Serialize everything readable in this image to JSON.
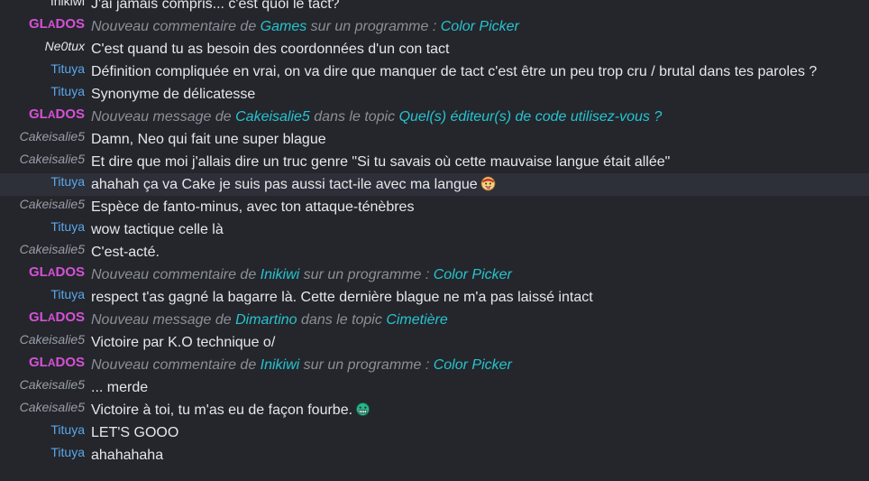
{
  "messages": [
    {
      "author": "Inikiwi",
      "type": "user",
      "text": "J'ai jamais compris... c'est quoi le tact?"
    },
    {
      "author": "GLADOS",
      "type": "system",
      "parts": [
        "Nouveau commentaire de ",
        "Games",
        " sur un programme : ",
        "Color Picker"
      ]
    },
    {
      "author": "Ne0tux",
      "type": "user",
      "text": "C'est quand tu as besoin des coordonnées d'un con tact"
    },
    {
      "author": "Tituya",
      "type": "user",
      "text": "Définition compliquée en vrai, on va dire que manquer de tact c'est être un peu trop cru / brutal dans tes paroles ?"
    },
    {
      "author": "Tituya",
      "type": "user",
      "text": "Synonyme de délicatesse"
    },
    {
      "author": "GLADOS",
      "type": "system",
      "parts": [
        "Nouveau message de ",
        "Cakeisalie5",
        " dans le topic ",
        "Quel(s) éditeur(s) de code utilisez-vous ?"
      ]
    },
    {
      "author": "Cakeisalie5",
      "type": "user",
      "text": "Damn, Neo qui fait une super blague"
    },
    {
      "author": "Cakeisalie5",
      "type": "user",
      "text": "Et dire que moi j'allais dire un truc genre \"Si tu savais où cette mauvaise langue était allée\""
    },
    {
      "author": "Tituya",
      "type": "user",
      "text": "ahahah ça va Cake je suis pas aussi tact-ile avec ma langue",
      "emoji": "tongue-emoji"
    },
    {
      "author": "Cakeisalie5",
      "type": "user",
      "text": "Espèce de fanto-minus, avec ton attaque-ténèbres"
    },
    {
      "author": "Tituya",
      "type": "user",
      "text": "wow tactique celle là"
    },
    {
      "author": "Cakeisalie5",
      "type": "user",
      "text": "C'est-acté."
    },
    {
      "author": "GLADOS",
      "type": "system",
      "parts": [
        "Nouveau commentaire de ",
        "Inikiwi",
        " sur un programme : ",
        "Color Picker"
      ]
    },
    {
      "author": "Tituya",
      "type": "user",
      "text": "respect t'as gagné la bagarre là. Cette dernière blague ne m'a pas laissé intact"
    },
    {
      "author": "GLADOS",
      "type": "system",
      "parts": [
        "Nouveau message de ",
        "Dimartino",
        " dans le topic ",
        "Cimetière"
      ]
    },
    {
      "author": "Cakeisalie5",
      "type": "user",
      "text": "Victoire par K.O technique o/"
    },
    {
      "author": "GLADOS",
      "type": "system",
      "parts": [
        "Nouveau commentaire de ",
        "Inikiwi",
        " sur un programme : ",
        "Color Picker"
      ]
    },
    {
      "author": "Cakeisalie5",
      "type": "user",
      "text": "... merde"
    },
    {
      "author": "Cakeisalie5",
      "type": "user",
      "text": "Victoire à toi, tu m'as eu de façon fourbe.",
      "emoji": "grin-emoji"
    },
    {
      "author": "Tituya",
      "type": "user",
      "text": "LET'S GOOO"
    },
    {
      "author": "Tituya",
      "type": "user",
      "text": "ahahahaha"
    }
  ],
  "colors": {
    "background": "#24262c",
    "highlight_row": "#2d3038",
    "text": "#e6e7ea",
    "tituya": "#5ba7ec",
    "cakeisalie5": "#9a9ea6",
    "glados": "#d651d6",
    "system_text": "#8b8f96",
    "system_link": "#26c4cf"
  }
}
